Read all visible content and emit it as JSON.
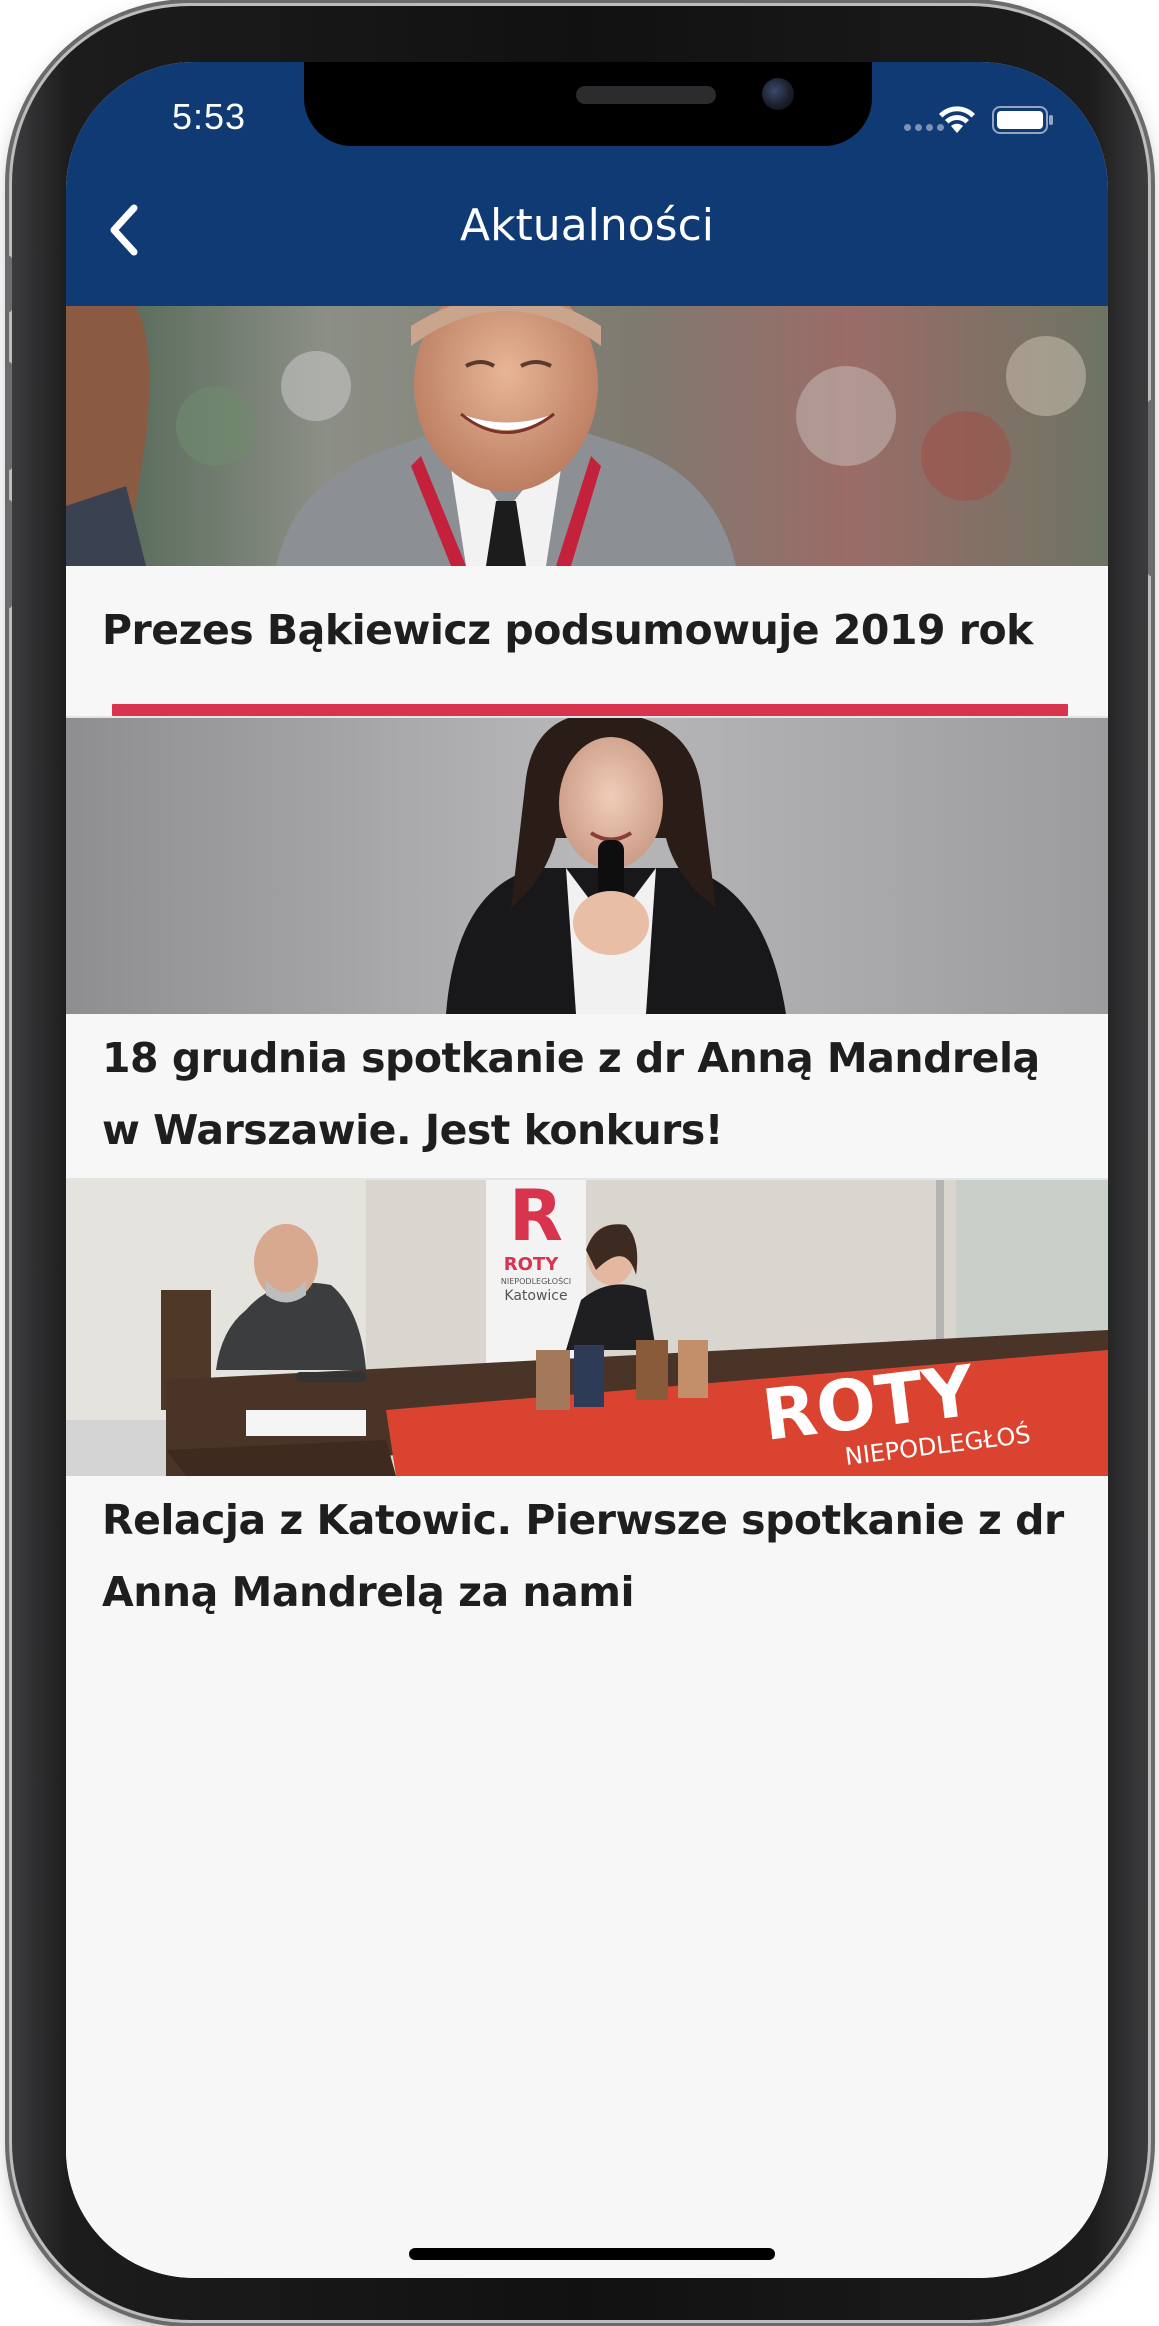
{
  "status_bar": {
    "time": "5:53",
    "background": "#0f3a73",
    "icons": [
      "signal-dots-icon",
      "wifi-icon",
      "battery-icon"
    ]
  },
  "nav": {
    "title": "Aktualności",
    "back_icon": "chevron-left-icon"
  },
  "news": [
    {
      "title": "Prezes Bąkiewicz podsumowuje 2019 rok",
      "image": "photo-smiling-man-in-suit"
    },
    {
      "title": "18 grudnia spotkanie z dr Anną Mandrelą w Warszawie. Jest konkurs!",
      "image": "photo-woman-speaking-into-microphone"
    },
    {
      "title": "Relacja z Katowic. Pierwsze spotkanie z dr Anną Mandrelą za nami",
      "image": "photo-panel-event",
      "banner_logo_text": "ROTY",
      "banner_logo_sub": "NIEPODLEGŁOŚCI",
      "banner_logo_city": "Katowice",
      "table_banner_text": "ROTY",
      "table_banner_sub": "NIEPODLEGŁOŚ"
    }
  ],
  "colors": {
    "accent": "#d8344e",
    "nav": "#0f3a73",
    "card_background": "#f7f7f8"
  }
}
